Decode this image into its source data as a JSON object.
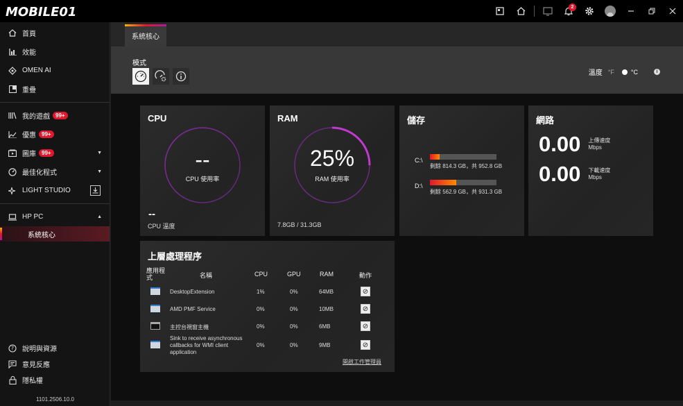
{
  "app": {
    "logo_text": "MOBILE01",
    "version": "1101.2506.10.0"
  },
  "titlebar": {
    "notification_count": "2"
  },
  "sidebar": {
    "items": [
      {
        "label": "首頁",
        "icon": "home-icon"
      },
      {
        "label": "效能",
        "icon": "performance-icon"
      },
      {
        "label": "OMEN AI",
        "icon": "omen-ai-icon"
      },
      {
        "label": "重疊",
        "icon": "overlay-icon"
      }
    ],
    "group2": [
      {
        "label": "我的遊戲",
        "icon": "games-icon",
        "badge": "99+"
      },
      {
        "label": "優惠",
        "icon": "deals-icon",
        "badge": "99+"
      },
      {
        "label": "圖庫",
        "icon": "gallery-icon",
        "badge": "99+"
      },
      {
        "label": "最佳化程式",
        "icon": "optimizer-icon"
      },
      {
        "label": "LIGHT STUDIO",
        "icon": "light-studio-icon"
      }
    ],
    "device": {
      "label": "HP PC",
      "sub": "系統核心"
    },
    "bottom": [
      {
        "label": "說明與資源",
        "icon": "help-icon"
      },
      {
        "label": "意見反應",
        "icon": "feedback-icon"
      },
      {
        "label": "隱私權",
        "icon": "privacy-icon"
      }
    ]
  },
  "main": {
    "tab": "系統核心",
    "mode_label": "模式",
    "temp_label": "溫度",
    "temp_f": "°F",
    "temp_c": "°C"
  },
  "cpu": {
    "title": "CPU",
    "value": "--",
    "sub": "CPU 使用率",
    "temp_value": "--",
    "temp_label": "CPU 溫度"
  },
  "ram": {
    "title": "RAM",
    "value": "25%",
    "usage_fraction": 0.25,
    "sub": "RAM 使用率",
    "foot": "7.8GB / 31.3GB"
  },
  "storage": {
    "title": "儲存",
    "drives": [
      {
        "label": "C:\\",
        "text": "剩餘 814.3 GB，共 952.8 GB",
        "used_fraction": 0.145
      },
      {
        "label": "D:\\",
        "text": "剩餘 562.9 GB，共 931.3 GB",
        "used_fraction": 0.395
      }
    ]
  },
  "network": {
    "title": "網路",
    "upload_value": "0.00",
    "upload_label": "上傳速度",
    "upload_unit": "Mbps",
    "download_value": "0.00",
    "download_label": "下載速度",
    "download_unit": "Mbps"
  },
  "processes": {
    "title": "上層處理程序",
    "headers": {
      "app": "應用程式",
      "name": "名稱",
      "cpu": "CPU",
      "gpu": "GPU",
      "ram": "RAM",
      "action": "動作"
    },
    "rows": [
      {
        "name": "DesktopExtension",
        "cpu": "1%",
        "gpu": "0%",
        "ram": "64MB",
        "icon": "window-icon"
      },
      {
        "name": "AMD PMF Service",
        "cpu": "0%",
        "gpu": "0%",
        "ram": "10MB",
        "icon": "window-icon"
      },
      {
        "name": "主控台視窗主機",
        "cpu": "0%",
        "gpu": "0%",
        "ram": "6MB",
        "icon": "console-icon"
      },
      {
        "name": "Sink to receive asynchronous callbacks for WMI client application",
        "cpu": "0%",
        "gpu": "0%",
        "ram": "9MB",
        "icon": "window-icon"
      }
    ],
    "task_manager_link": "開啟工作管理員"
  }
}
